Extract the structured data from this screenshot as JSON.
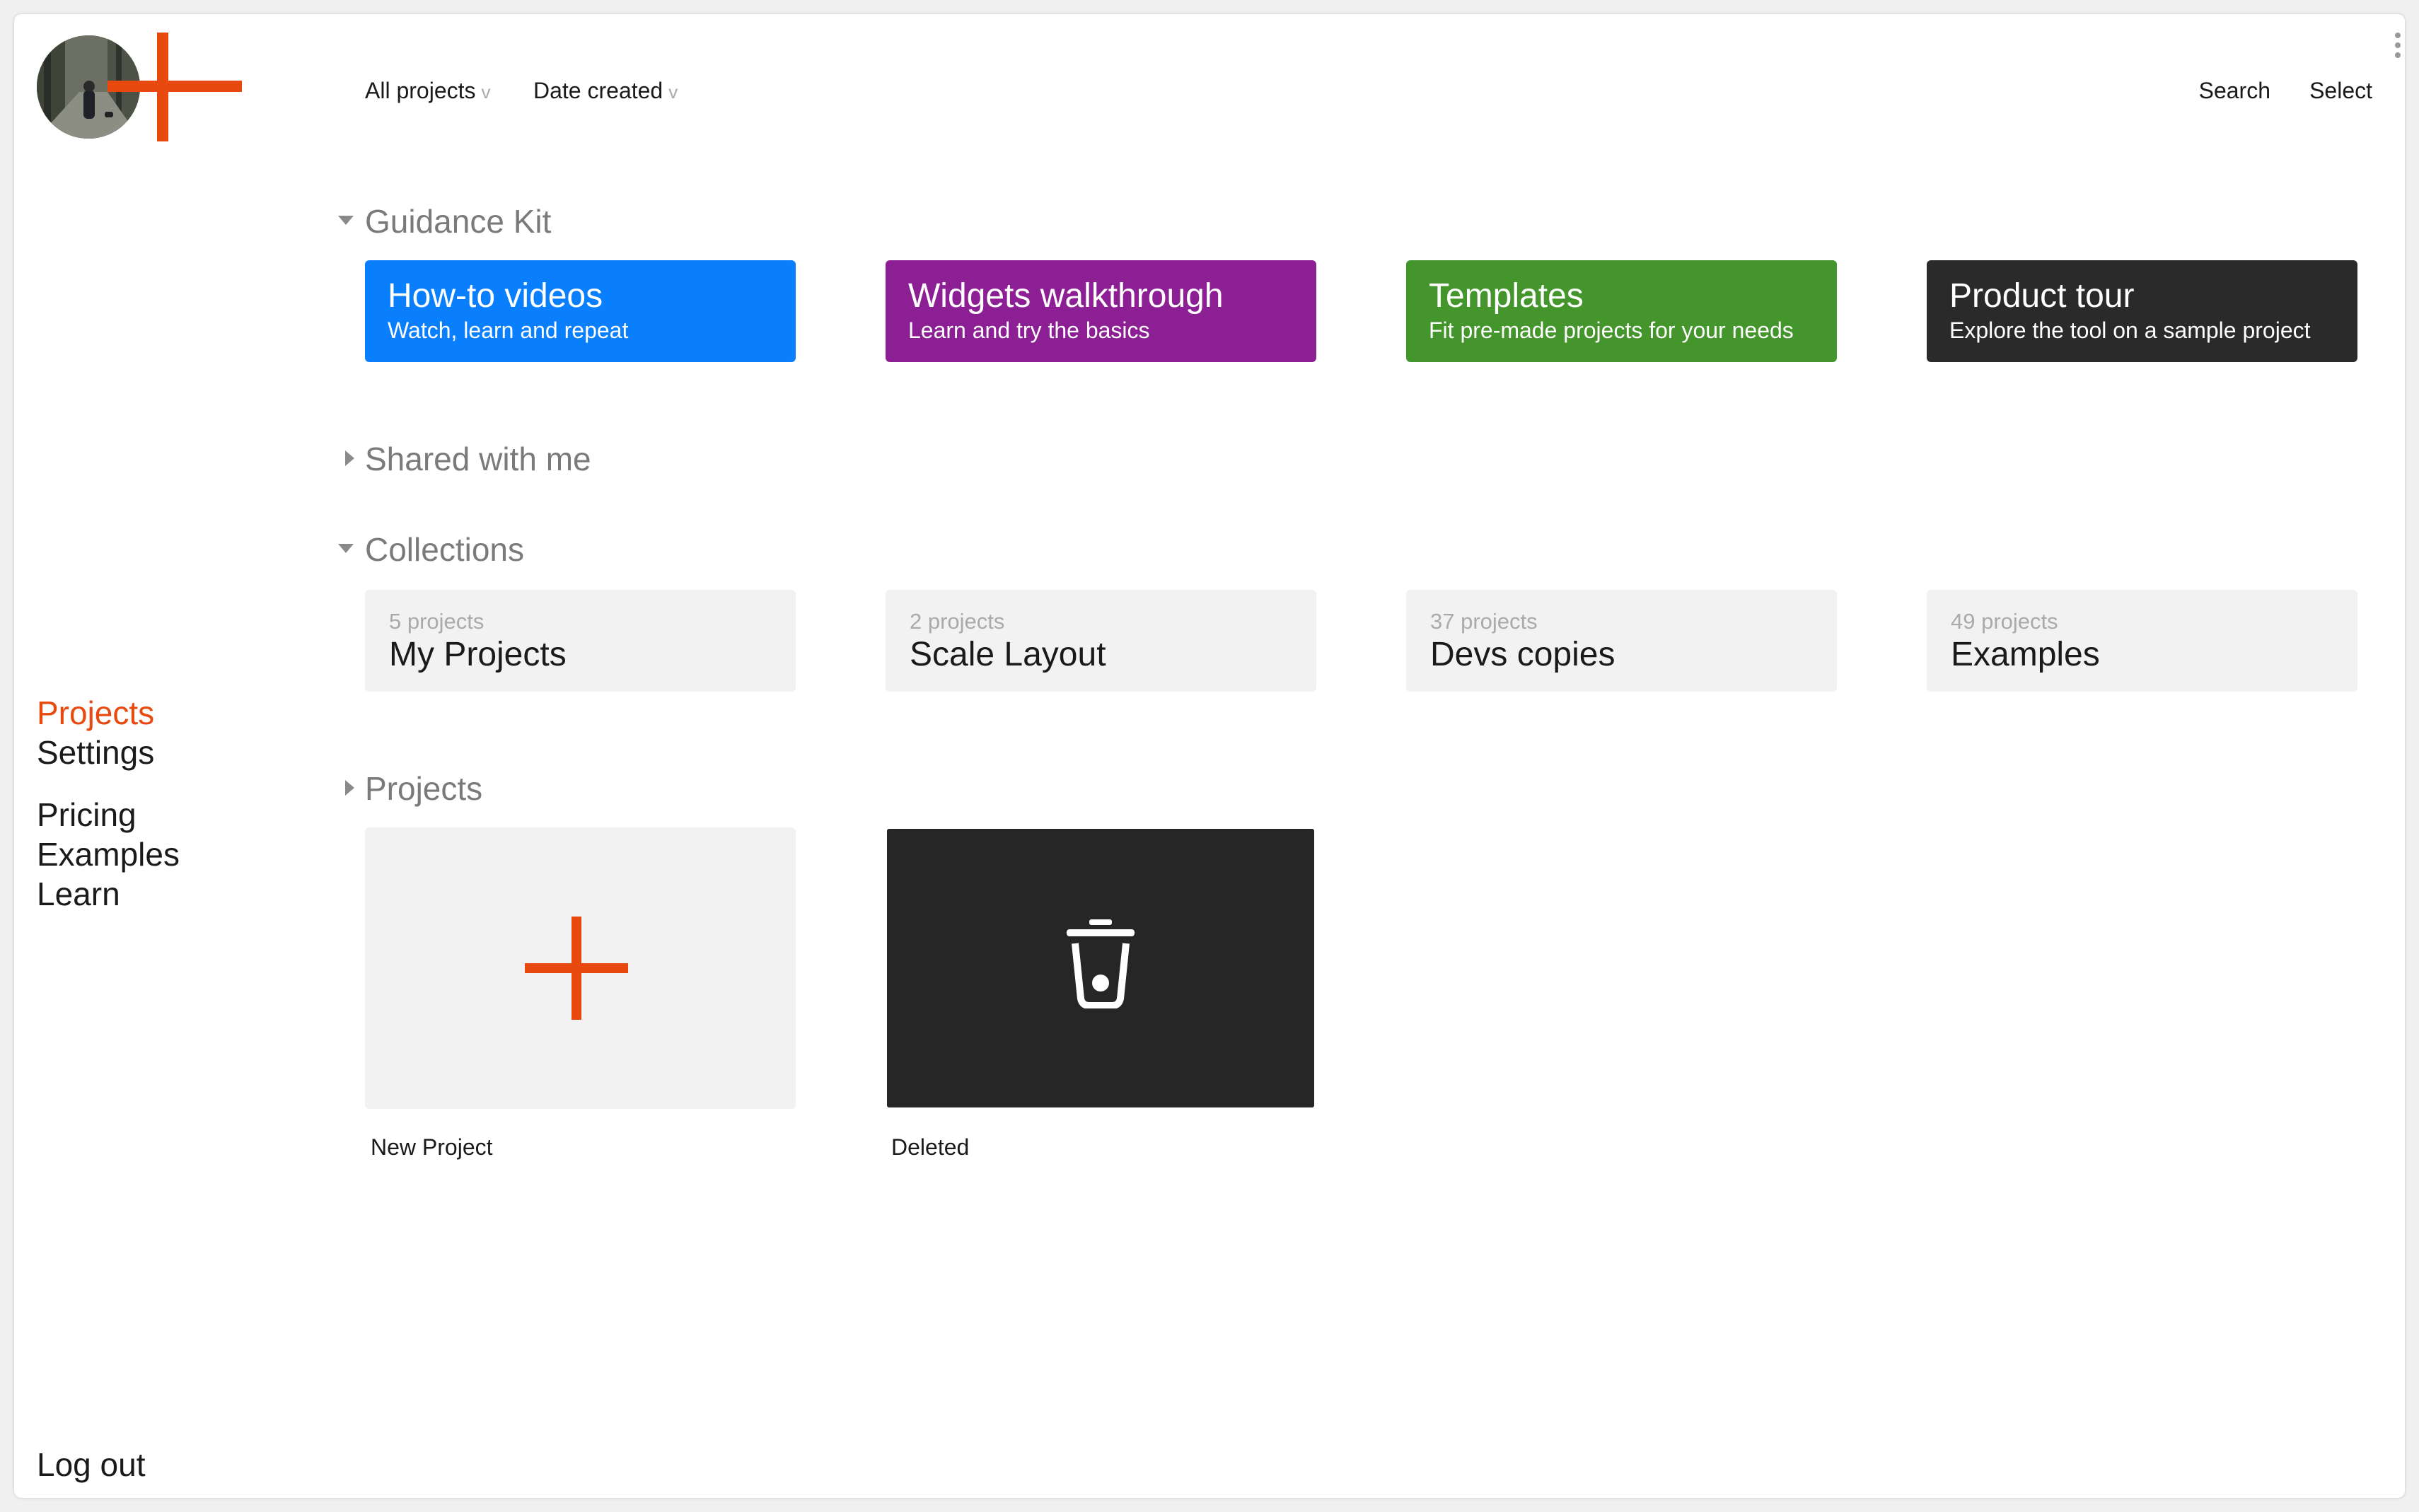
{
  "topbar": {
    "filter_projects": "All projects",
    "filter_date": "Date created",
    "chevron": "v",
    "search": "Search",
    "select": "Select"
  },
  "sidebar": {
    "logo_icon": "plus-logo-icon",
    "nav_primary": [
      "Projects",
      "Settings"
    ],
    "nav_secondary": [
      "Pricing",
      "Examples",
      "Learn"
    ],
    "active": "Projects",
    "logout": "Log out"
  },
  "sections": {
    "guidance": "Guidance Kit",
    "shared": "Shared with me",
    "collections": "Collections",
    "projects": "Projects"
  },
  "guidance_kit": [
    {
      "title": "How-to videos",
      "subtitle": "Watch, learn and repeat",
      "color": "#0a7ffe"
    },
    {
      "title": "Widgets walkthrough",
      "subtitle": "Learn and try the basics",
      "color": "#8c1f94"
    },
    {
      "title": "Templates",
      "subtitle": "Fit pre-made projects for your needs",
      "color": "#43952c"
    },
    {
      "title": "Product tour",
      "subtitle": "Explore the tool on a sample project",
      "color": "#2a2a2a"
    }
  ],
  "collections": [
    {
      "count": "5 projects",
      "name": "My Projects"
    },
    {
      "count": "2 projects",
      "name": "Scale Layout"
    },
    {
      "count": "37 projects",
      "name": "Devs copies"
    },
    {
      "count": "49 projects",
      "name": "Examples"
    }
  ],
  "projects": {
    "new_label": "New Project",
    "new_icon": "plus-icon",
    "deleted_label": "Deleted",
    "deleted_icon": "trash-icon"
  },
  "colors": {
    "accent": "#e8490f",
    "muted_header": "#7a7a7a",
    "card_bg": "#f2f2f2",
    "dark_tile": "#262626"
  }
}
